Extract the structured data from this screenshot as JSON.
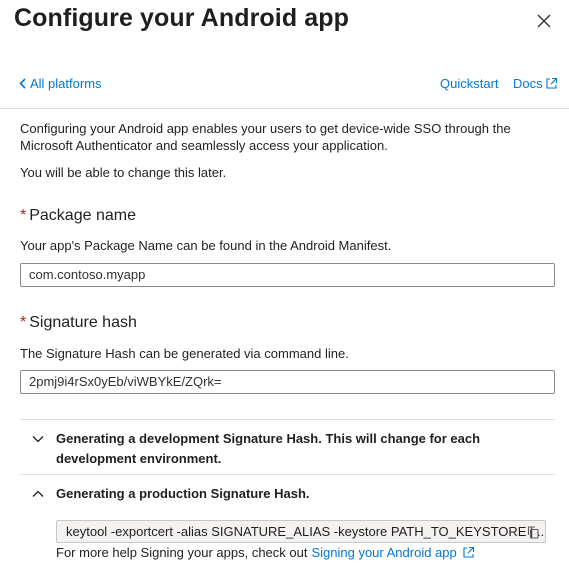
{
  "header": {
    "title": "Configure your Android app"
  },
  "nav": {
    "back_label": "All platforms",
    "quickstart_label": "Quickstart",
    "docs_label": "Docs"
  },
  "intro": {
    "text": "Configuring your Android app enables your users to get device-wide SSO through the Microsoft Authenticator and seamlessly access your application.",
    "later": "You will be able to change this later."
  },
  "package": {
    "required_mark": "*",
    "label": "Package name",
    "help": "Your app's Package Name can be found in the Android Manifest.",
    "value": "com.contoso.myapp"
  },
  "signature": {
    "required_mark": "*",
    "label": "Signature hash",
    "help": "The Signature Hash can be generated via command line.",
    "value": "2pmj9i4rSx0yEb/viWBYkE/ZQrk="
  },
  "accordions": [
    {
      "label": "Generating a development Signature Hash. This will change for each development environment.",
      "expanded": false
    },
    {
      "label": "Generating a production Signature Hash.",
      "expanded": true
    }
  ],
  "production": {
    "command": "keytool -exportcert -alias SIGNATURE_ALIAS -keystore PATH_TO_KEYSTORE | ...",
    "help_prefix": "For more help Signing your apps, check out",
    "help_link": "Signing your Android app"
  },
  "colors": {
    "link": "#0078d4",
    "required": "#a4262c",
    "text": "#201f1e"
  }
}
